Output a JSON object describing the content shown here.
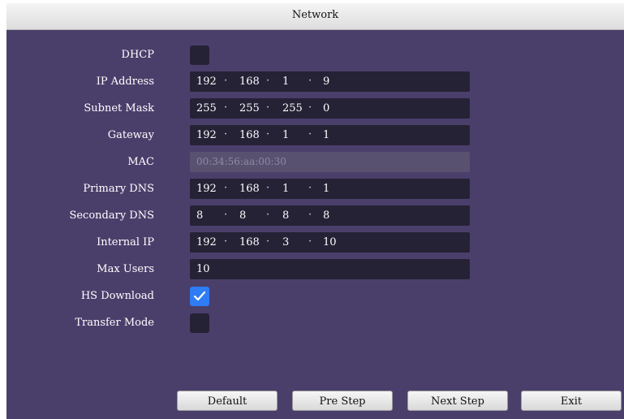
{
  "window": {
    "title": "Network"
  },
  "fields": {
    "dhcp": {
      "label": "DHCP",
      "checked": false
    },
    "ip_address": {
      "label": "IP Address",
      "octets": [
        "192",
        "168",
        "1",
        "9"
      ]
    },
    "subnet_mask": {
      "label": "Subnet Mask",
      "octets": [
        "255",
        "255",
        "255",
        "0"
      ]
    },
    "gateway": {
      "label": "Gateway",
      "octets": [
        "192",
        "168",
        "1",
        "1"
      ]
    },
    "mac": {
      "label": "MAC",
      "value": "00:34:56:aa:00:30"
    },
    "primary_dns": {
      "label": "Primary DNS",
      "octets": [
        "192",
        "168",
        "1",
        "1"
      ]
    },
    "secondary_dns": {
      "label": "Secondary DNS",
      "octets": [
        "8",
        "8",
        "8",
        "8"
      ]
    },
    "internal_ip": {
      "label": "Internal IP",
      "octets": [
        "192",
        "168",
        "3",
        "10"
      ]
    },
    "max_users": {
      "label": "Max Users",
      "value": "10"
    },
    "hs_download": {
      "label": "HS Download",
      "checked": true
    },
    "transfer_mode": {
      "label": "Transfer Mode",
      "checked": false
    }
  },
  "ip_separator": "·",
  "buttons": {
    "default": "Default",
    "pre_step": "Pre Step",
    "next_step": "Next Step",
    "exit": "Exit"
  },
  "colors": {
    "panel": "#4a3f6b",
    "field": "#262236",
    "field_disabled": "#585270",
    "check_accent": "#2e7cf6"
  }
}
